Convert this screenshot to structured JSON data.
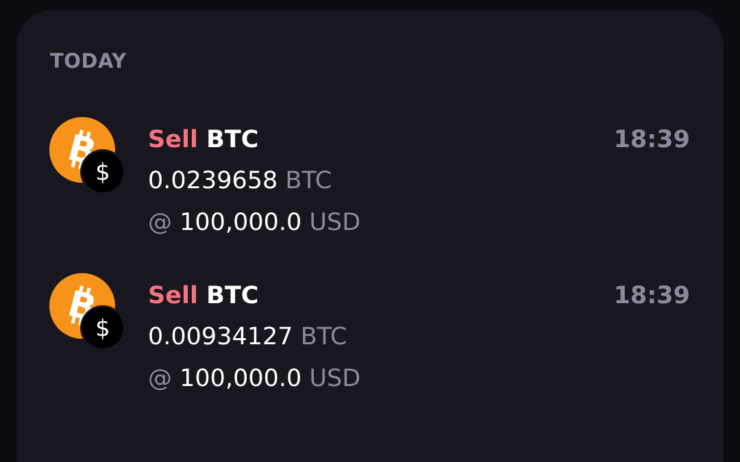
{
  "history": {
    "section_label": "TODAY",
    "trades": [
      {
        "side": "Sell",
        "asset": "BTC",
        "time": "18:39",
        "amount": "0.0239658",
        "amount_unit": "BTC",
        "at_symbol": "@",
        "price": "100,000.0",
        "price_unit": "USD",
        "base_icon": "bitcoin-icon",
        "quote_icon": "dollar-icon"
      },
      {
        "side": "Sell",
        "asset": "BTC",
        "time": "18:39",
        "amount": "0.00934127",
        "amount_unit": "BTC",
        "at_symbol": "@",
        "price": "100,000.0",
        "price_unit": "USD",
        "base_icon": "bitcoin-icon",
        "quote_icon": "dollar-icon"
      }
    ]
  },
  "colors": {
    "background": "#0d0a12",
    "card": "#18161f",
    "sell": "#f4737f",
    "muted": "#8b8a9b",
    "bitcoin": "#f7931a",
    "text": "#ffffff"
  }
}
